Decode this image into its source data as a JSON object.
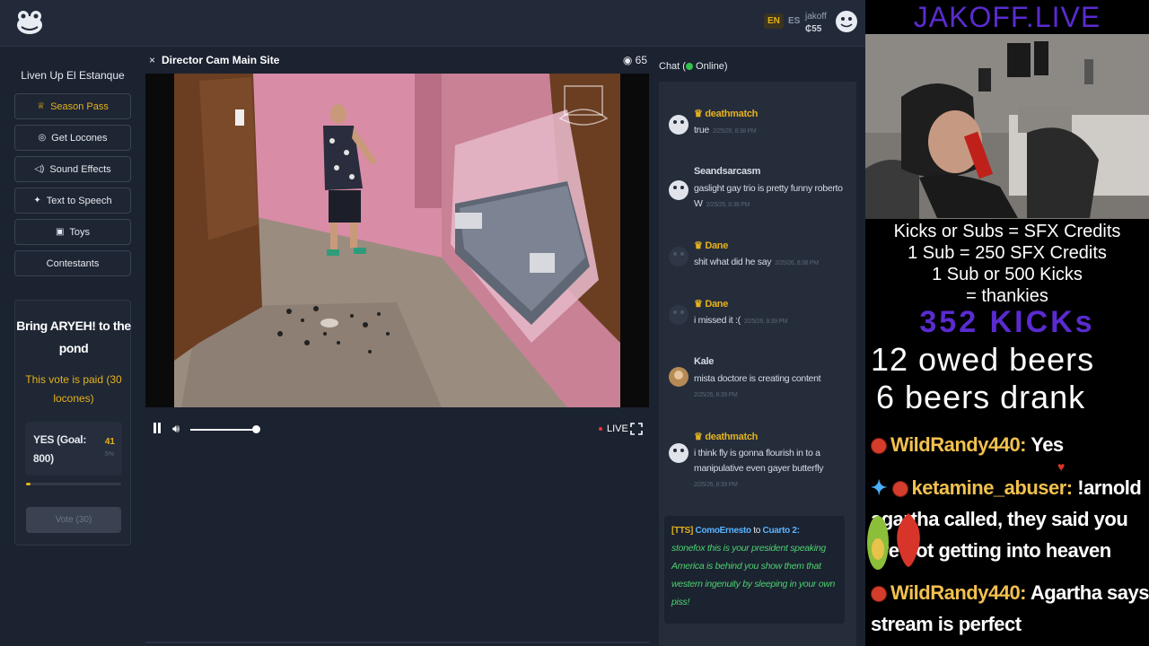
{
  "header": {
    "lang_en": "EN",
    "lang_es": "ES",
    "username": "jakoff",
    "balance": "₵55"
  },
  "sidebar": {
    "title": "Liven Up El Estanque",
    "items": [
      {
        "label": "Season Pass",
        "icon": "crown-icon"
      },
      {
        "label": "Get Locones",
        "icon": "coin-icon"
      },
      {
        "label": "Sound Effects",
        "icon": "speaker-icon"
      },
      {
        "label": "Text to Speech",
        "icon": "sparkle-icon"
      },
      {
        "label": "Toys",
        "icon": "gift-icon"
      },
      {
        "label": "Contestants",
        "icon": ""
      }
    ]
  },
  "vote": {
    "title": "Bring ARYEH! to the pond",
    "paid_note": "This vote is paid (30 locones)",
    "option_label": "YES (Goal: 800)",
    "option_count": "41",
    "option_percent": "5%",
    "progress": 0.05,
    "button_label": "Vote (30)"
  },
  "camera": {
    "close": "×",
    "title": "Director Cam Main Site",
    "viewers": "65",
    "live_label": "LIVE",
    "volume": 1.0
  },
  "chat": {
    "header_prefix": "Chat (",
    "header_suffix": " Online)",
    "messages": [
      {
        "name": "deathmatch",
        "text": "true",
        "time": "2/25/26, 8:38 PM"
      },
      {
        "name": "Seandsarcasm",
        "text": "gaslight gay trio is pretty funny roberto W",
        "time": "2/25/26, 8:38 PM"
      },
      {
        "name": "Dane",
        "text": "shit what did he say",
        "time": "2/25/26, 8:38 PM"
      },
      {
        "name": "Dane",
        "text": "i missed it :(",
        "time": "2/25/26, 8:39 PM"
      },
      {
        "name": "Kale",
        "text": "mista doctore is creating content",
        "time": "2/25/26, 8:39 PM"
      },
      {
        "name": "deathmatch",
        "text": "i think fly is gonna flourish in to a manipulative even gayer butterfly",
        "time": "2/25/26, 8:39 PM"
      }
    ],
    "tts": {
      "tag": "[TTS]",
      "from": "ComoErnesto",
      "to_word": "to",
      "to": "Cuarto 2:",
      "text": "stonefox this is your president speaking America is behind you show them that western ingenuity by sleeping in your own piss!"
    }
  },
  "overlay": {
    "brand": "JAKOFF.LIVE",
    "info_lines": [
      "Kicks or Subs = SFX Credits",
      "1 Sub = 250 SFX Credits",
      "1 Sub or 500 Kicks",
      "= thankies"
    ],
    "kicks": "352 KICKs",
    "owed_beers": "12 owed beers",
    "beers_drank": "6 beers drank",
    "chat": [
      {
        "user": "WildRandy440:",
        "text": "Yes"
      },
      {
        "user": "ketamine_abuser:",
        "text": "!arnold"
      },
      {
        "text": "agartha called, they said you"
      },
      {
        "text": "are not getting into heaven"
      },
      {
        "user": "WildRandy440:",
        "text": "Agartha says"
      },
      {
        "text": "stream is perfect"
      }
    ]
  },
  "colors": {
    "accent": "#e4b21c",
    "online": "#33c24d",
    "tts_text": "#4dd16e",
    "brand_purple": "#5a2bd0"
  }
}
